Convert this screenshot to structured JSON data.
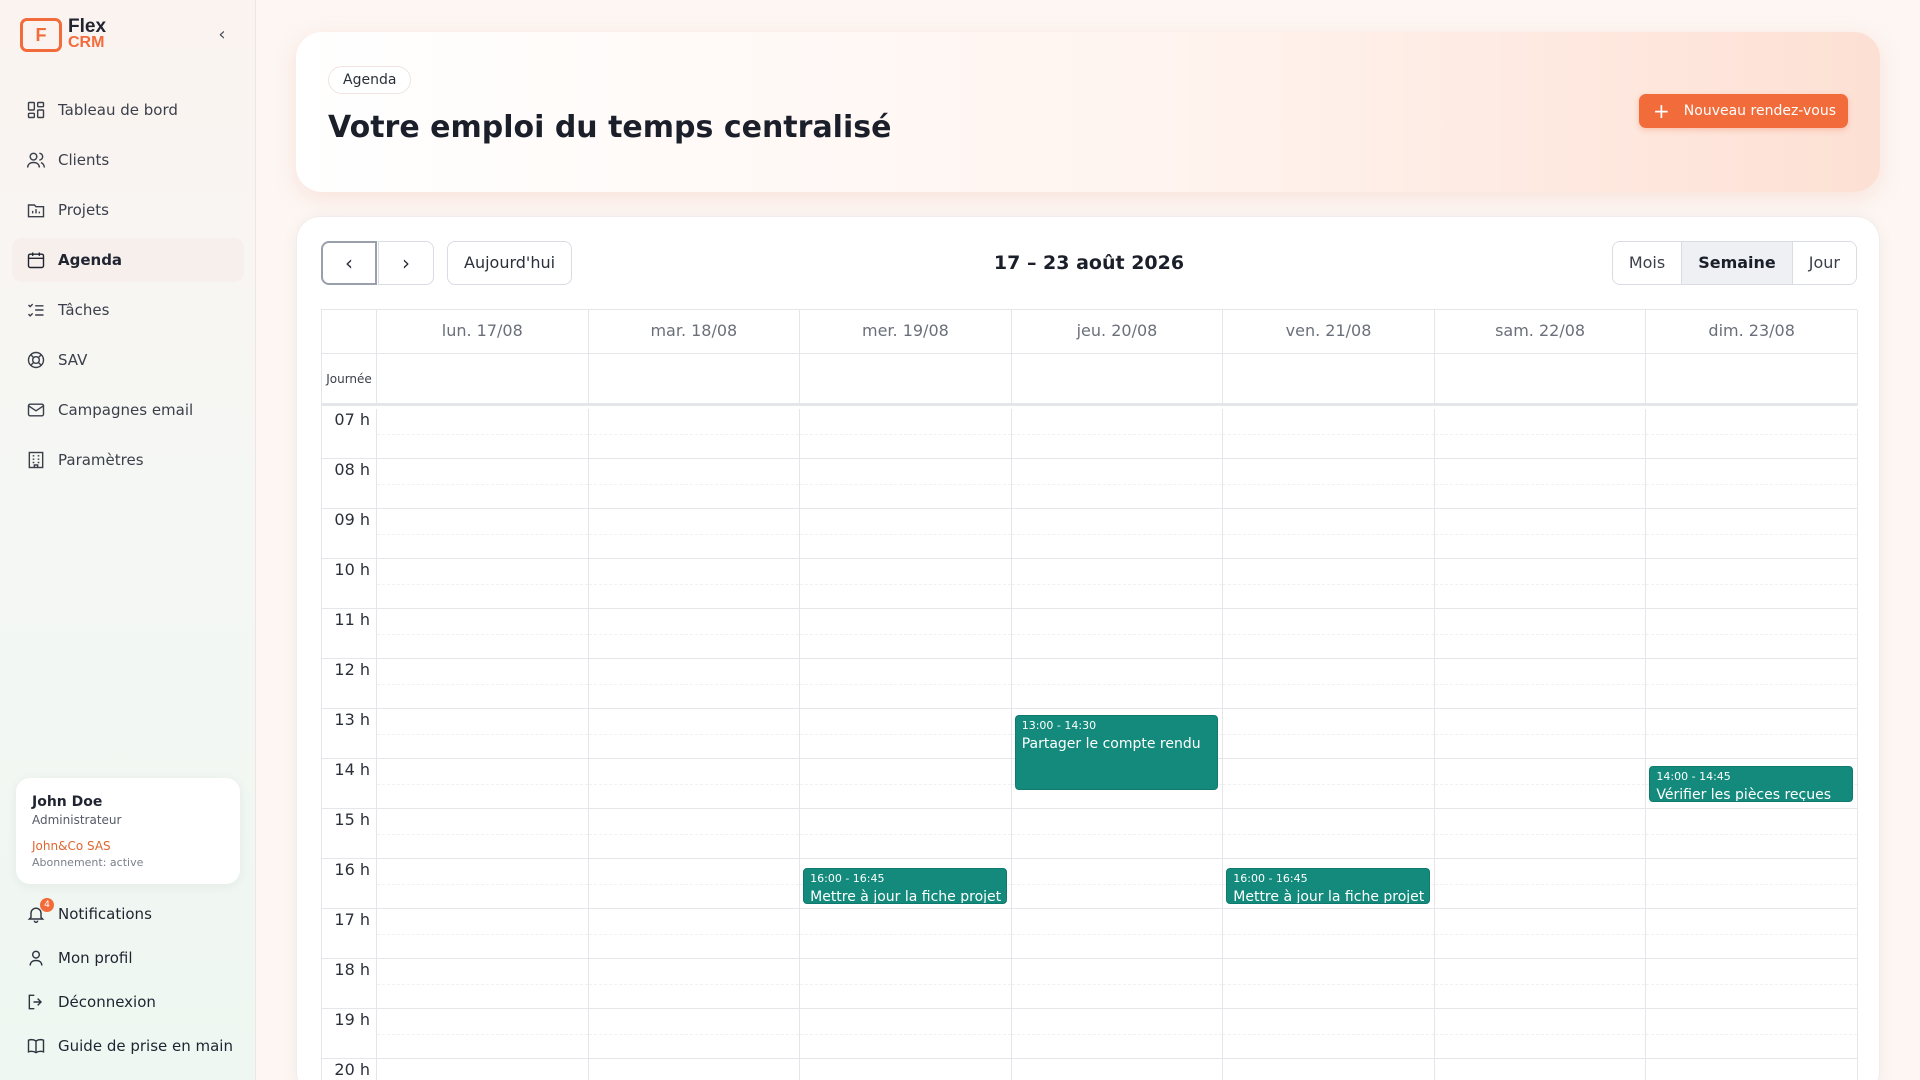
{
  "app": {
    "logo_mark": "F",
    "logo_line1": "Flex",
    "logo_line2": "CRM",
    "collapse_symbol": "‹"
  },
  "sidebar": {
    "items": [
      {
        "label": "Tableau de bord",
        "icon": "dashboard-icon"
      },
      {
        "label": "Clients",
        "icon": "users-icon"
      },
      {
        "label": "Projets",
        "icon": "folder-chart-icon"
      },
      {
        "label": "Agenda",
        "icon": "calendar-icon",
        "active": true
      },
      {
        "label": "Tâches",
        "icon": "tasks-list-icon"
      },
      {
        "label": "SAV",
        "icon": "lifebuoy-icon"
      },
      {
        "label": "Campagnes email",
        "icon": "mail-icon"
      },
      {
        "label": "Paramètres",
        "icon": "building-icon"
      }
    ]
  },
  "user": {
    "name": "John Doe",
    "role": "Administrateur",
    "company": "John&Co SAS",
    "subscription": "Abonnement: active"
  },
  "bottom_links": {
    "notifications": "Notifications",
    "notifications_count": "4",
    "profile": "Mon profil",
    "logout": "Déconnexion",
    "guide": "Guide de prise en main"
  },
  "header": {
    "pill": "Agenda",
    "title": "Votre emploi du temps centralisé",
    "new_button_plus": "+",
    "new_button": "Nouveau rendez-vous"
  },
  "calendar": {
    "prev_symbol": "‹",
    "next_symbol": "›",
    "today": "Aujourd'hui",
    "range": "17 – 23 août 2026",
    "views": {
      "month": "Mois",
      "week": "Semaine",
      "day": "Jour"
    },
    "active_view": "Semaine",
    "days": [
      "lun. 17/08",
      "mar. 18/08",
      "mer. 19/08",
      "jeu. 20/08",
      "ven. 21/08",
      "sam. 22/08",
      "dim. 23/08"
    ],
    "all_day_label": "Journée",
    "hours": [
      "07 h",
      "08 h",
      "09 h",
      "10 h",
      "11 h",
      "12 h",
      "13 h",
      "14 h",
      "15 h",
      "16 h",
      "17 h",
      "18 h",
      "19 h",
      "20 h"
    ],
    "first_hour": 7,
    "events": [
      {
        "day": 3,
        "start": 13.0,
        "end": 14.5,
        "time": "13:00 - 14:30",
        "title": "Partager le compte rendu"
      },
      {
        "day": 6,
        "start": 14.0,
        "end": 14.75,
        "time": "14:00 - 14:45",
        "title": "Vérifier les pièces reçues"
      },
      {
        "day": 2,
        "start": 16.0,
        "end": 16.75,
        "time": "16:00 - 16:45",
        "title": "Mettre à jour la fiche projet"
      },
      {
        "day": 4,
        "start": 16.0,
        "end": 16.75,
        "time": "16:00 - 16:45",
        "title": "Mettre à jour la fiche projet"
      }
    ],
    "event_color": "#138a7c"
  }
}
